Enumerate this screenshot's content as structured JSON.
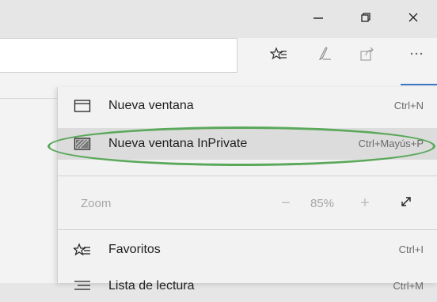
{
  "window_controls": {
    "minimize_icon": "minimize-icon",
    "restore_icon": "restore-icon",
    "close_icon": "close-icon"
  },
  "toolbar": {
    "icons": [
      "favorites-icon",
      "pen-icon",
      "share-icon",
      "more-icon"
    ],
    "accent_color": "#3a74c4"
  },
  "menu": {
    "items": [
      {
        "label": "Nueva ventana",
        "shortcut": "Ctrl+N",
        "icon": "window-icon"
      },
      {
        "label": "Nueva ventana InPrivate",
        "shortcut": "Ctrl+Mayús+P",
        "icon": "inprivate-window-icon",
        "highlighted": true,
        "annotation_color": "#5aa85a"
      },
      {
        "label": "Favoritos",
        "shortcut": "Ctrl+I",
        "icon": "favorites-icon"
      },
      {
        "label": "Lista de lectura",
        "shortcut": "Ctrl+M",
        "icon": "reading-list-icon"
      }
    ],
    "zoom": {
      "label": "Zoom",
      "value": "85%",
      "minus": "−",
      "plus": "+"
    }
  }
}
